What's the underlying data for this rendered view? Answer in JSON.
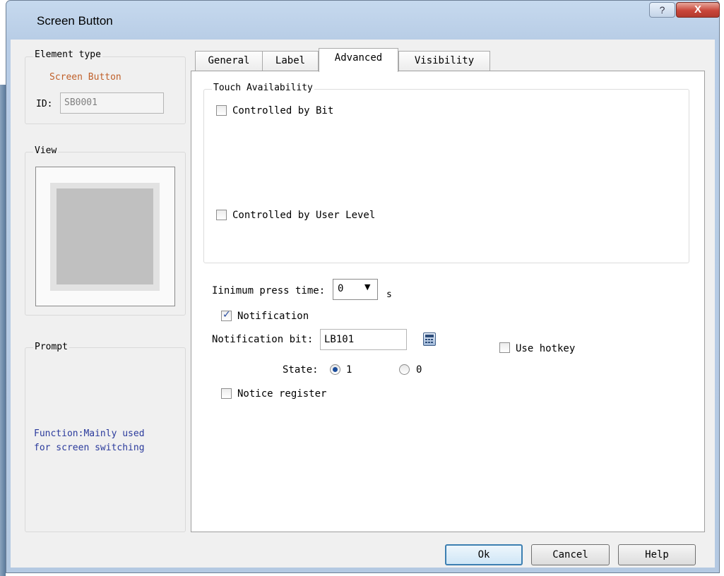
{
  "window": {
    "title": "Screen Button",
    "help_glyph": "?",
    "close_glyph": "X"
  },
  "element_type": {
    "group_title": "Element type",
    "value": "Screen Button",
    "id_label": "ID:",
    "id_value": "SB0001"
  },
  "view": {
    "group_title": "View"
  },
  "prompt": {
    "group_title": "Prompt",
    "text_line1": "Function:Mainly used",
    "text_line2": "for screen switching"
  },
  "tabs": [
    {
      "label": "General",
      "active": false
    },
    {
      "label": "Label",
      "active": false
    },
    {
      "label": "Advanced",
      "active": true
    },
    {
      "label": "Visibility",
      "active": false
    }
  ],
  "advanced": {
    "touch_availability": {
      "group_title": "Touch Availability",
      "controlled_by_bit": {
        "label": "Controlled by Bit",
        "checked": false
      },
      "controlled_by_user_level": {
        "label": "Controlled by User Level",
        "checked": false
      }
    },
    "min_press_time": {
      "label": "Iinimum press time:",
      "value": "0",
      "unit": "s"
    },
    "notification": {
      "label": "Notification",
      "checked": true
    },
    "notification_bit": {
      "label": "Notification bit:",
      "value": "LB101"
    },
    "state": {
      "label": "State:",
      "options": [
        {
          "value": "1",
          "selected": true
        },
        {
          "value": "0",
          "selected": false
        }
      ]
    },
    "notice_register": {
      "label": "Notice register",
      "checked": false
    },
    "use_hotkey": {
      "label": "Use hotkey",
      "checked": false
    }
  },
  "buttons": {
    "ok": "Ok",
    "cancel": "Cancel",
    "help": "Help"
  },
  "colors": {
    "element_type_value": "#c0602a",
    "prompt_text": "#2a3a9c",
    "title_bar": "#b8cde6",
    "close_button": "#c9463a"
  }
}
